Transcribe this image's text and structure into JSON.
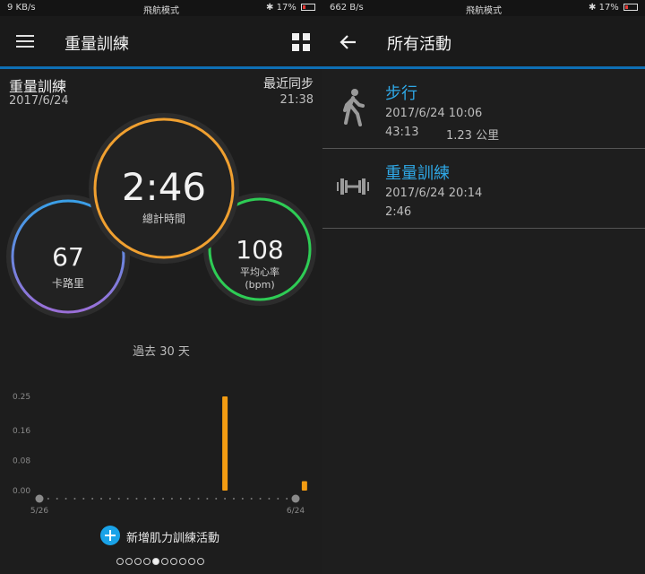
{
  "left_screen": {
    "status": {
      "left": "9 KB/s",
      "center": "飛航模式",
      "right": "17%"
    },
    "title": "重量訓練",
    "summary": {
      "title": "重量訓練",
      "date": "2017/6/24",
      "sync_label": "最近同步",
      "sync_time": "21:38"
    },
    "stats": {
      "total_time": {
        "value": "2:46",
        "label": "總計時間"
      },
      "calories": {
        "value": "67",
        "label": "卡路里"
      },
      "heart_rate": {
        "value": "108",
        "label": "平均心率",
        "unit": "(bpm)"
      }
    },
    "range_label": "過去 30 天",
    "add_button": "新增肌力訓練活動",
    "pager": {
      "count": 10,
      "active": 4
    }
  },
  "chart_data": {
    "type": "bar",
    "x_start": "5/26",
    "x_end": "6/24",
    "yticks": [
      "0.25",
      "0.16",
      "0.08",
      "0.00"
    ],
    "ylim": [
      0,
      0.25
    ],
    "bars": [
      {
        "day": 21,
        "value": 0.25
      },
      {
        "day": 30,
        "value": 0.025
      }
    ],
    "bar_color": "#f39c12",
    "grid": false
  },
  "right_screen": {
    "status": {
      "left": "662 B/s",
      "center": "飛航模式",
      "right": "17%"
    },
    "title": "所有活動",
    "activities": [
      {
        "icon": "walking-icon",
        "name": "步行",
        "datetime": "2017/6/24 10:06",
        "duration": "43:13",
        "distance": "1.23 公里"
      },
      {
        "icon": "dumbbell-icon",
        "name": "重量訓練",
        "datetime": "2017/6/24 20:14",
        "duration": "2:46",
        "distance": ""
      }
    ]
  },
  "colors": {
    "accent_blue": "#0e6fb5",
    "time_ring": "#f0a030",
    "calorie_ring_start": "#3aa0e8",
    "calorie_ring_end": "#9b6fd8",
    "heart_ring": "#2ecc55",
    "link_blue": "#2fa8e6"
  }
}
